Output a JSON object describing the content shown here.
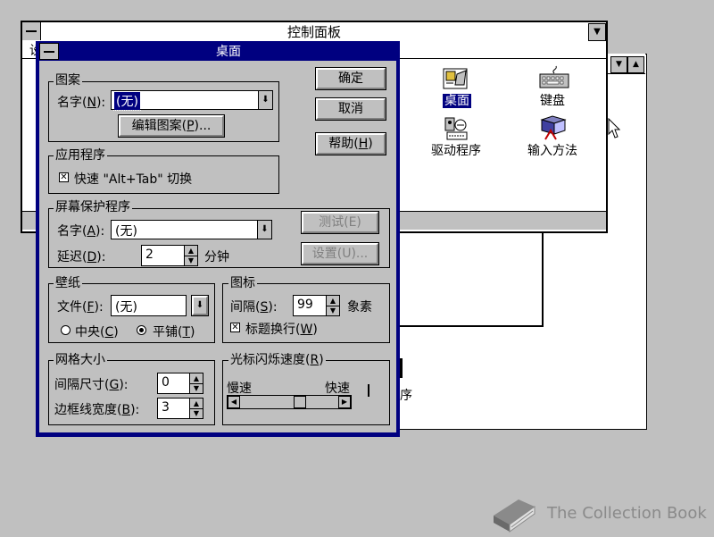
{
  "control_panel": {
    "title": "控制面板",
    "menubar_letter": "设",
    "max_glyph": "▼",
    "icons": [
      {
        "label": "桌面",
        "selected": true
      },
      {
        "label": "键盘",
        "selected": false
      },
      {
        "label": "驱动程序",
        "selected": false
      },
      {
        "label": "输入方法",
        "selected": false
      }
    ]
  },
  "back_window": {
    "partial_text": "序",
    "btn_down": "▼",
    "btn_up": "▲"
  },
  "dialog": {
    "title": "桌面",
    "buttons": {
      "ok": "确定",
      "cancel": "取消",
      "help_pre": "帮助(",
      "help_key": "H",
      "help_post": ")"
    },
    "pattern": {
      "group_label": "图案",
      "name_pre": "名字(",
      "name_key": "N",
      "name_post": "):",
      "name_value": "(无)",
      "edit_pre": "编辑图案(",
      "edit_key": "P",
      "edit_post": ")..."
    },
    "applications": {
      "group_label": "应用程序",
      "fast_switch_label": "快速 \"Alt+Tab\" 切换",
      "fast_switch_checked": true
    },
    "screensaver": {
      "group_label": "屏幕保护程序",
      "name_pre": "名字(",
      "name_key": "A",
      "name_post": "):",
      "name_value": "(无)",
      "delay_pre": "延迟(",
      "delay_key": "D",
      "delay_post": "):",
      "delay_value": "2",
      "delay_unit": "分钟",
      "test_label": "测试(E)",
      "setup_label": "设置(U)..."
    },
    "wallpaper": {
      "group_label": "壁纸",
      "file_pre": "文件(",
      "file_key": "F",
      "file_post": "):",
      "file_value": "(无)",
      "center_pre": "中央(",
      "center_key": "C",
      "center_post": ")",
      "tile_pre": "平铺(",
      "tile_key": "T",
      "tile_post": ")",
      "selected": "tile"
    },
    "icons": {
      "group_label": "图标",
      "spacing_pre": "间隔(",
      "spacing_key": "S",
      "spacing_post": "):",
      "spacing_value": "99",
      "spacing_unit": "象素",
      "wrap_pre": "标题换行(",
      "wrap_key": "W",
      "wrap_post": ")",
      "wrap_checked": true
    },
    "grid": {
      "group_label": "网格大小",
      "gran_pre": "间隔尺寸(",
      "gran_key": "G",
      "gran_post": "):",
      "gran_value": "0",
      "border_pre": "边框线宽度(",
      "border_key": "B",
      "border_post": "):",
      "border_value": "3"
    },
    "cursor_blink": {
      "group_label_pre": "光标闪烁速度(",
      "group_label_key": "R",
      "group_label_post": ")",
      "slow_label": "慢速",
      "fast_label": "快速",
      "left_arrow": "◀",
      "right_arrow": "▶",
      "rate_fraction": 0.63
    },
    "arrows": {
      "combo": "⬇",
      "spin_up": "▲",
      "spin_down": "▼",
      "check": "✕"
    }
  },
  "watermark": {
    "text": "The Collection Book",
    "icon": "book-icon"
  }
}
